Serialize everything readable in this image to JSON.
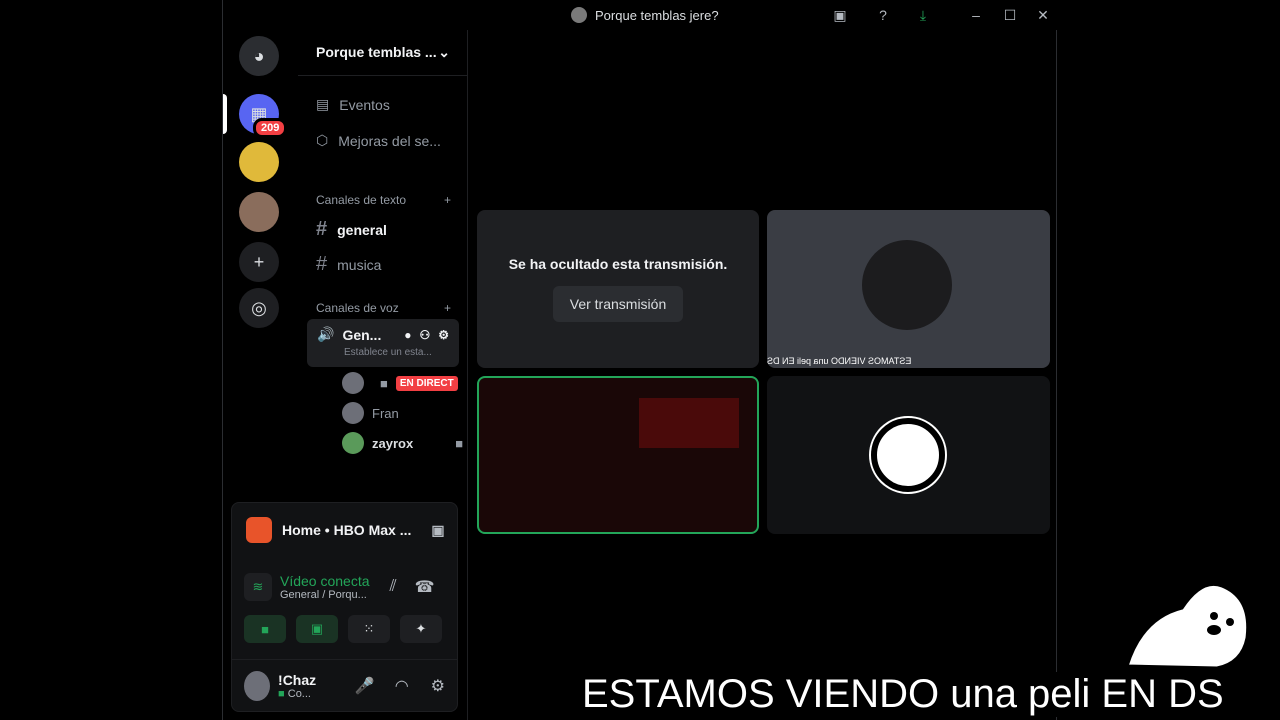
{
  "window": {
    "title": "Porque temblas jere?"
  },
  "guild": {
    "name": "Porque temblas ..."
  },
  "nav": {
    "events": "Eventos",
    "boosts": "Mejoras del se..."
  },
  "text_category": "Canales de texto",
  "text_channels": [
    "general",
    "musica"
  ],
  "voice_category": "Canales de voz",
  "voice_channel": {
    "name": "Gen...",
    "status": "Establece un esta..."
  },
  "members": [
    {
      "name": "",
      "live": "EN DIRECT"
    },
    {
      "name": "Fran"
    },
    {
      "name": "zayrox"
    }
  ],
  "badges": {
    "unread": "209"
  },
  "activity": {
    "title": "Home • HBO Max ..."
  },
  "voice_status": {
    "state": "Vídeo conecta",
    "location": "General / Porqu..."
  },
  "user": {
    "name": "!Chaz",
    "status": "Co..."
  },
  "stage": {
    "hidden_message": "Se ha ocultado esta transmisión.",
    "view_button": "Ver transmisión",
    "cam_overlay": "ESTAMOS VIENDO una peli EN DS"
  },
  "caption": "ESTAMOS VIENDO una peli EN DS",
  "colors": {
    "accent_green": "#23a559",
    "live_red": "#f23f43",
    "bg": "#000000"
  }
}
